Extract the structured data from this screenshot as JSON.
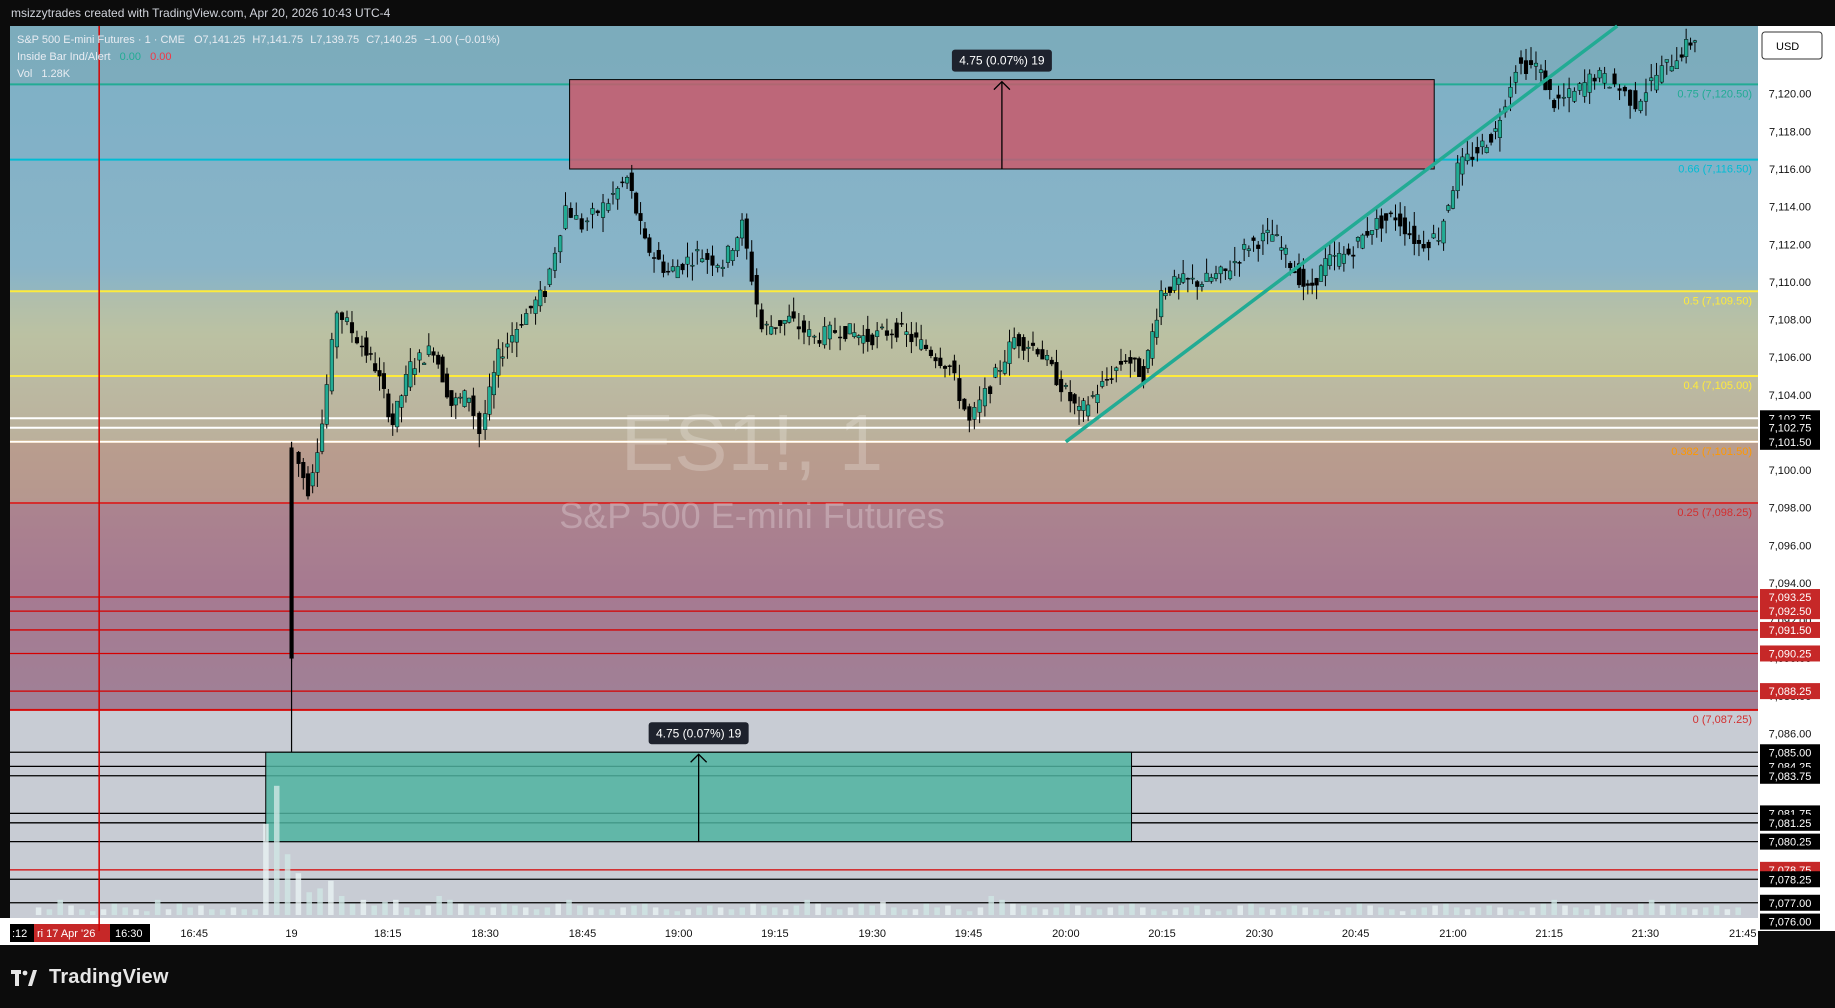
{
  "header": {
    "watermark_caption": "msizzytrades created with TradingView.com, Apr 20, 2026 10:43 UTC-4"
  },
  "legend": {
    "symbol_line": "S&P 500 E-mini Futures · 1 · CME",
    "ohlc": {
      "o": "O7,141.25",
      "h": "H7,141.75",
      "l": "L7,139.75",
      "c": "C7,140.25",
      "chg": "−1.00 (−0.01%)"
    },
    "indicator_name": "Inside Bar Ind/Alert",
    "indicator_val1": "0.00",
    "indicator_val2": "0.00",
    "vol_label": "Vol",
    "vol_value": "1.28K"
  },
  "currency": "USD",
  "brand": "TradingView",
  "chart_data": {
    "type": "candlestick",
    "symbol_watermark": "ES1!, 1",
    "name_watermark": "S&P 500 E-mini Futures",
    "colors": {
      "up": "#22ab94",
      "down": "#000000",
      "fib_top": "#22ab94",
      "fib_066": "#00bcd4",
      "fib_05": "#ffeb3b",
      "fib_0382": "#ff9800",
      "fib_025": "#d32f2f",
      "red_line": "#d50000",
      "accent_red": "#c62828"
    },
    "ylim": [
      7075.5,
      7123.6
    ],
    "xlim": [
      0,
      1490
    ],
    "y_ticks": [
      "7,086.00",
      "7,088.00",
      "7,090.00",
      "7,092.00",
      "7,094.00",
      "7,096.00",
      "7,098.00",
      "7,100.00",
      "7,102.00",
      "7,104.00",
      "7,106.00",
      "7,108.00",
      "7,110.00",
      "7,112.00",
      "7,114.00",
      "7,116.00",
      "7,118.00",
      "7,120.00"
    ],
    "x_labels": [
      {
        "label": "16:45",
        "x": 157
      },
      {
        "label": "19",
        "x": 240
      },
      {
        "label": "18:15",
        "x": 322
      },
      {
        "label": "18:30",
        "x": 405
      },
      {
        "label": "18:45",
        "x": 488
      },
      {
        "label": "19:00",
        "x": 570
      },
      {
        "label": "19:15",
        "x": 652
      },
      {
        "label": "19:30",
        "x": 735
      },
      {
        "label": "19:45",
        "x": 817
      },
      {
        "label": "20:00",
        "x": 900
      },
      {
        "label": "20:15",
        "x": 982
      },
      {
        "label": "20:30",
        "x": 1065
      },
      {
        "label": "20:45",
        "x": 1147
      },
      {
        "label": "21:00",
        "x": 1230
      },
      {
        "label": "21:15",
        "x": 1312
      },
      {
        "label": "21:30",
        "x": 1394
      },
      {
        "label": "21:45",
        "x": 1477
      }
    ],
    "cursor_time_labels": [
      ":12",
      "ri 17 Apr '26",
      "16:30"
    ],
    "fib_levels": [
      {
        "ratio": "0.75 (7,120.50)",
        "price": 7120.5,
        "color": "#22ab94"
      },
      {
        "ratio": "0.66 (7,116.50)",
        "price": 7116.5,
        "color": "#00bcd4"
      },
      {
        "ratio": "0.5 (7,109.50)",
        "price": 7109.5,
        "color": "#ffeb3b"
      },
      {
        "ratio": "0.4 (7,105.00)",
        "price": 7105.0,
        "color": "#ffeb3b"
      },
      {
        "ratio": "0.382 (7,101.50)",
        "price": 7101.5,
        "color": "#ff9800"
      },
      {
        "ratio": "0.25 (7,098.25)",
        "price": 7098.25,
        "color": "#d32f2f"
      },
      {
        "ratio": "0 (7,087.25)",
        "price": 7087.25,
        "color": "#d32f2f"
      }
    ],
    "horizontal_lines": [
      {
        "price": 7102.75,
        "label": "7,102.75",
        "color": "#ffffff",
        "tag_bg": "#000000"
      },
      {
        "price": 7102.25,
        "label": "7,102.75",
        "color": "#ffffff",
        "tag_bg": "#000000"
      },
      {
        "price": 7101.5,
        "label": "7,101.50",
        "color": "#ffffff",
        "tag_bg": "#000000"
      },
      {
        "price": 7093.25,
        "label": "7,093.25",
        "color": "#d50000",
        "tag_bg": "#c62828"
      },
      {
        "price": 7092.5,
        "label": "7,092.50",
        "color": "#d50000",
        "tag_bg": "#c62828"
      },
      {
        "price": 7091.5,
        "label": "7,091.50",
        "color": "#d50000",
        "tag_bg": "#c62828"
      },
      {
        "price": 7090.25,
        "label": "7,090.25",
        "color": "#d50000",
        "tag_bg": "#c62828"
      },
      {
        "price": 7088.25,
        "label": "7,088.25",
        "color": "#d50000",
        "tag_bg": "#c62828"
      },
      {
        "price": 7087.25,
        "label": "",
        "color": "#d50000",
        "tag_bg": ""
      },
      {
        "price": 7085.0,
        "label": "7,085.00",
        "color": "#000000",
        "tag_bg": "#000000"
      },
      {
        "price": 7084.25,
        "label": "7,084.25",
        "color": "#000000",
        "tag_bg": "#000000"
      },
      {
        "price": 7083.75,
        "label": "7,083.75",
        "color": "#000000",
        "tag_bg": "#000000"
      },
      {
        "price": 7081.75,
        "label": "7,081.75",
        "color": "#000000",
        "tag_bg": "#000000"
      },
      {
        "price": 7081.25,
        "label": "7,081.25",
        "color": "#000000",
        "tag_bg": "#000000"
      },
      {
        "price": 7080.25,
        "label": "7,080.25",
        "color": "#000000",
        "tag_bg": "#000000"
      },
      {
        "price": 7078.75,
        "label": "7,078.75",
        "color": "#d50000",
        "tag_bg": "#c62828"
      },
      {
        "price": 7078.25,
        "label": "7,078.25",
        "color": "#000000",
        "tag_bg": "#000000"
      },
      {
        "price": 7077.0,
        "label": "7,077.00",
        "color": "#000000",
        "tag_bg": "#000000"
      },
      {
        "price": 7076.0,
        "label": "7,076.00",
        "color": "#000000",
        "tag_bg": "#000000"
      }
    ],
    "measure_boxes": [
      {
        "label": "4.75 (0.07%) 19",
        "x0": 477,
        "x1": 1214,
        "p0": 7116.0,
        "p1": 7120.75,
        "color": "#c85a6b",
        "direction": "up"
      },
      {
        "label": "4.75 (0.07%) 19",
        "x0": 218,
        "x1": 956,
        "p0": 7080.25,
        "p1": 7085.0,
        "color": "#4fb3a0",
        "direction": "up"
      }
    ],
    "trendline": {
      "x0": 900,
      "p0": 7101.5,
      "x1": 1370,
      "p1": 7123.6,
      "color": "#22ab94"
    },
    "vertical_line_x": 76,
    "candle_path": [
      {
        "x": 240,
        "p": 7090.0
      },
      {
        "x": 246,
        "p": 7101.0
      },
      {
        "x": 258,
        "p": 7099.0
      },
      {
        "x": 270,
        "p": 7102.5
      },
      {
        "x": 283,
        "p": 7108.5
      },
      {
        "x": 300,
        "p": 7107.0
      },
      {
        "x": 315,
        "p": 7105.5
      },
      {
        "x": 330,
        "p": 7102.5
      },
      {
        "x": 345,
        "p": 7105.5
      },
      {
        "x": 365,
        "p": 7106.5
      },
      {
        "x": 380,
        "p": 7103.5
      },
      {
        "x": 395,
        "p": 7104.0
      },
      {
        "x": 405,
        "p": 7102.0
      },
      {
        "x": 420,
        "p": 7106.0
      },
      {
        "x": 440,
        "p": 7108.0
      },
      {
        "x": 460,
        "p": 7109.5
      },
      {
        "x": 478,
        "p": 7114.0
      },
      {
        "x": 492,
        "p": 7113.0
      },
      {
        "x": 510,
        "p": 7114.0
      },
      {
        "x": 530,
        "p": 7115.5
      },
      {
        "x": 545,
        "p": 7112.0
      },
      {
        "x": 565,
        "p": 7110.5
      },
      {
        "x": 590,
        "p": 7111.5
      },
      {
        "x": 612,
        "p": 7111.0
      },
      {
        "x": 628,
        "p": 7113.0
      },
      {
        "x": 645,
        "p": 7107.5
      },
      {
        "x": 668,
        "p": 7108.0
      },
      {
        "x": 690,
        "p": 7107.0
      },
      {
        "x": 712,
        "p": 7107.5
      },
      {
        "x": 735,
        "p": 7107.0
      },
      {
        "x": 760,
        "p": 7107.5
      },
      {
        "x": 785,
        "p": 7106.5
      },
      {
        "x": 805,
        "p": 7105.5
      },
      {
        "x": 822,
        "p": 7102.5
      },
      {
        "x": 840,
        "p": 7104.5
      },
      {
        "x": 860,
        "p": 7107.0
      },
      {
        "x": 880,
        "p": 7106.5
      },
      {
        "x": 900,
        "p": 7104.5
      },
      {
        "x": 915,
        "p": 7103.0
      },
      {
        "x": 935,
        "p": 7104.5
      },
      {
        "x": 955,
        "p": 7106.0
      },
      {
        "x": 970,
        "p": 7105.0
      },
      {
        "x": 985,
        "p": 7109.5
      },
      {
        "x": 1000,
        "p": 7110.0
      },
      {
        "x": 1020,
        "p": 7110.0
      },
      {
        "x": 1040,
        "p": 7110.5
      },
      {
        "x": 1060,
        "p": 7112.0
      },
      {
        "x": 1080,
        "p": 7112.5
      },
      {
        "x": 1095,
        "p": 7111.0
      },
      {
        "x": 1110,
        "p": 7109.5
      },
      {
        "x": 1125,
        "p": 7111.0
      },
      {
        "x": 1145,
        "p": 7111.5
      },
      {
        "x": 1165,
        "p": 7113.0
      },
      {
        "x": 1185,
        "p": 7113.5
      },
      {
        "x": 1205,
        "p": 7112.0
      },
      {
        "x": 1222,
        "p": 7112.5
      },
      {
        "x": 1238,
        "p": 7116.0
      },
      {
        "x": 1255,
        "p": 7117.0
      },
      {
        "x": 1270,
        "p": 7118.0
      },
      {
        "x": 1288,
        "p": 7121.5
      },
      {
        "x": 1305,
        "p": 7121.5
      },
      {
        "x": 1320,
        "p": 7119.5
      },
      {
        "x": 1338,
        "p": 7120.0
      },
      {
        "x": 1355,
        "p": 7121.0
      },
      {
        "x": 1372,
        "p": 7120.5
      },
      {
        "x": 1390,
        "p": 7119.5
      },
      {
        "x": 1408,
        "p": 7121.0
      },
      {
        "x": 1425,
        "p": 7122.0
      },
      {
        "x": 1440,
        "p": 7123.0
      }
    ],
    "volume_heights": [
      4,
      3,
      8,
      5,
      3,
      2,
      3,
      6,
      4,
      3,
      2,
      8,
      3,
      6,
      4,
      5,
      3,
      3,
      4,
      3,
      3,
      48,
      68,
      32,
      22,
      12,
      14,
      18,
      10,
      6,
      8,
      5,
      7,
      8,
      4,
      3,
      5,
      10,
      8,
      6,
      5,
      4,
      4,
      6,
      5,
      4,
      3,
      4,
      6,
      8,
      5,
      4,
      3,
      3,
      4,
      5,
      6,
      4,
      3,
      2,
      3,
      4,
      5,
      4,
      3,
      4,
      6,
      5,
      4,
      3,
      5,
      8,
      6,
      4,
      3,
      4,
      6,
      5,
      7,
      4,
      3,
      3,
      6,
      4,
      5,
      3,
      2,
      4,
      10,
      8,
      6,
      5,
      4,
      3,
      4,
      6,
      5,
      4,
      3,
      4,
      5,
      6,
      4,
      3,
      2,
      3,
      4,
      5,
      3,
      2,
      3,
      5,
      6,
      4,
      3,
      4,
      5,
      4,
      3,
      2,
      3,
      4,
      6,
      5,
      4,
      3,
      2,
      3,
      4,
      5,
      6,
      4,
      3,
      4,
      5,
      4,
      3,
      2,
      4,
      6,
      8,
      5,
      4,
      3,
      5,
      6,
      4,
      3,
      6,
      8,
      5,
      6,
      4,
      3,
      4,
      5,
      3,
      4
    ]
  }
}
